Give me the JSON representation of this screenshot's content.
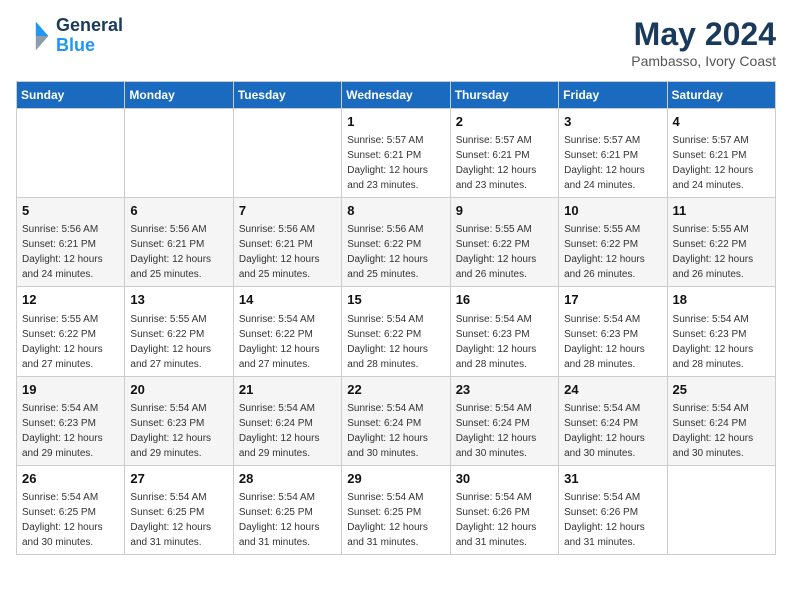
{
  "header": {
    "logo_line1": "General",
    "logo_line2": "Blue",
    "month_year": "May 2024",
    "location": "Pambasso, Ivory Coast"
  },
  "days_of_week": [
    "Sunday",
    "Monday",
    "Tuesday",
    "Wednesday",
    "Thursday",
    "Friday",
    "Saturday"
  ],
  "weeks": [
    [
      null,
      null,
      null,
      {
        "day": "1",
        "sunrise": "5:57 AM",
        "sunset": "6:21 PM",
        "daylight": "12 hours and 23 minutes."
      },
      {
        "day": "2",
        "sunrise": "5:57 AM",
        "sunset": "6:21 PM",
        "daylight": "12 hours and 23 minutes."
      },
      {
        "day": "3",
        "sunrise": "5:57 AM",
        "sunset": "6:21 PM",
        "daylight": "12 hours and 24 minutes."
      },
      {
        "day": "4",
        "sunrise": "5:57 AM",
        "sunset": "6:21 PM",
        "daylight": "12 hours and 24 minutes."
      }
    ],
    [
      {
        "day": "5",
        "sunrise": "5:56 AM",
        "sunset": "6:21 PM",
        "daylight": "12 hours and 24 minutes."
      },
      {
        "day": "6",
        "sunrise": "5:56 AM",
        "sunset": "6:21 PM",
        "daylight": "12 hours and 25 minutes."
      },
      {
        "day": "7",
        "sunrise": "5:56 AM",
        "sunset": "6:21 PM",
        "daylight": "12 hours and 25 minutes."
      },
      {
        "day": "8",
        "sunrise": "5:56 AM",
        "sunset": "6:22 PM",
        "daylight": "12 hours and 25 minutes."
      },
      {
        "day": "9",
        "sunrise": "5:55 AM",
        "sunset": "6:22 PM",
        "daylight": "12 hours and 26 minutes."
      },
      {
        "day": "10",
        "sunrise": "5:55 AM",
        "sunset": "6:22 PM",
        "daylight": "12 hours and 26 minutes."
      },
      {
        "day": "11",
        "sunrise": "5:55 AM",
        "sunset": "6:22 PM",
        "daylight": "12 hours and 26 minutes."
      }
    ],
    [
      {
        "day": "12",
        "sunrise": "5:55 AM",
        "sunset": "6:22 PM",
        "daylight": "12 hours and 27 minutes."
      },
      {
        "day": "13",
        "sunrise": "5:55 AM",
        "sunset": "6:22 PM",
        "daylight": "12 hours and 27 minutes."
      },
      {
        "day": "14",
        "sunrise": "5:54 AM",
        "sunset": "6:22 PM",
        "daylight": "12 hours and 27 minutes."
      },
      {
        "day": "15",
        "sunrise": "5:54 AM",
        "sunset": "6:22 PM",
        "daylight": "12 hours and 28 minutes."
      },
      {
        "day": "16",
        "sunrise": "5:54 AM",
        "sunset": "6:23 PM",
        "daylight": "12 hours and 28 minutes."
      },
      {
        "day": "17",
        "sunrise": "5:54 AM",
        "sunset": "6:23 PM",
        "daylight": "12 hours and 28 minutes."
      },
      {
        "day": "18",
        "sunrise": "5:54 AM",
        "sunset": "6:23 PM",
        "daylight": "12 hours and 28 minutes."
      }
    ],
    [
      {
        "day": "19",
        "sunrise": "5:54 AM",
        "sunset": "6:23 PM",
        "daylight": "12 hours and 29 minutes."
      },
      {
        "day": "20",
        "sunrise": "5:54 AM",
        "sunset": "6:23 PM",
        "daylight": "12 hours and 29 minutes."
      },
      {
        "day": "21",
        "sunrise": "5:54 AM",
        "sunset": "6:24 PM",
        "daylight": "12 hours and 29 minutes."
      },
      {
        "day": "22",
        "sunrise": "5:54 AM",
        "sunset": "6:24 PM",
        "daylight": "12 hours and 30 minutes."
      },
      {
        "day": "23",
        "sunrise": "5:54 AM",
        "sunset": "6:24 PM",
        "daylight": "12 hours and 30 minutes."
      },
      {
        "day": "24",
        "sunrise": "5:54 AM",
        "sunset": "6:24 PM",
        "daylight": "12 hours and 30 minutes."
      },
      {
        "day": "25",
        "sunrise": "5:54 AM",
        "sunset": "6:24 PM",
        "daylight": "12 hours and 30 minutes."
      }
    ],
    [
      {
        "day": "26",
        "sunrise": "5:54 AM",
        "sunset": "6:25 PM",
        "daylight": "12 hours and 30 minutes."
      },
      {
        "day": "27",
        "sunrise": "5:54 AM",
        "sunset": "6:25 PM",
        "daylight": "12 hours and 31 minutes."
      },
      {
        "day": "28",
        "sunrise": "5:54 AM",
        "sunset": "6:25 PM",
        "daylight": "12 hours and 31 minutes."
      },
      {
        "day": "29",
        "sunrise": "5:54 AM",
        "sunset": "6:25 PM",
        "daylight": "12 hours and 31 minutes."
      },
      {
        "day": "30",
        "sunrise": "5:54 AM",
        "sunset": "6:26 PM",
        "daylight": "12 hours and 31 minutes."
      },
      {
        "day": "31",
        "sunrise": "5:54 AM",
        "sunset": "6:26 PM",
        "daylight": "12 hours and 31 minutes."
      },
      null
    ]
  ]
}
